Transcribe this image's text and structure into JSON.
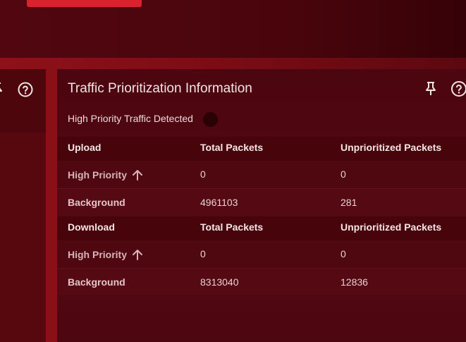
{
  "panel": {
    "title": "Traffic Prioritization Information",
    "detect_label": "High Priority Traffic Detected",
    "detect_status_color": "#2a0205"
  },
  "upload": {
    "headers": [
      "Upload",
      "Total Packets",
      "Unprioritized Packets"
    ],
    "rows": [
      {
        "label": "High Priority",
        "total": "0",
        "unprioritized": "0",
        "icon": "arrow-up-icon"
      },
      {
        "label": "Background",
        "total": "4961103",
        "unprioritized": "281"
      }
    ]
  },
  "download": {
    "headers": [
      "Download",
      "Total Packets",
      "Unprioritized Packets"
    ],
    "rows": [
      {
        "label": "High Priority",
        "total": "0",
        "unprioritized": "0",
        "icon": "arrow-up-icon"
      },
      {
        "label": "Background",
        "total": "8313040",
        "unprioritized": "12836"
      }
    ]
  },
  "colors": {
    "accent_red": "#d9222d",
    "panel_bg": "#4c0610",
    "gutter": "#8a1018"
  }
}
